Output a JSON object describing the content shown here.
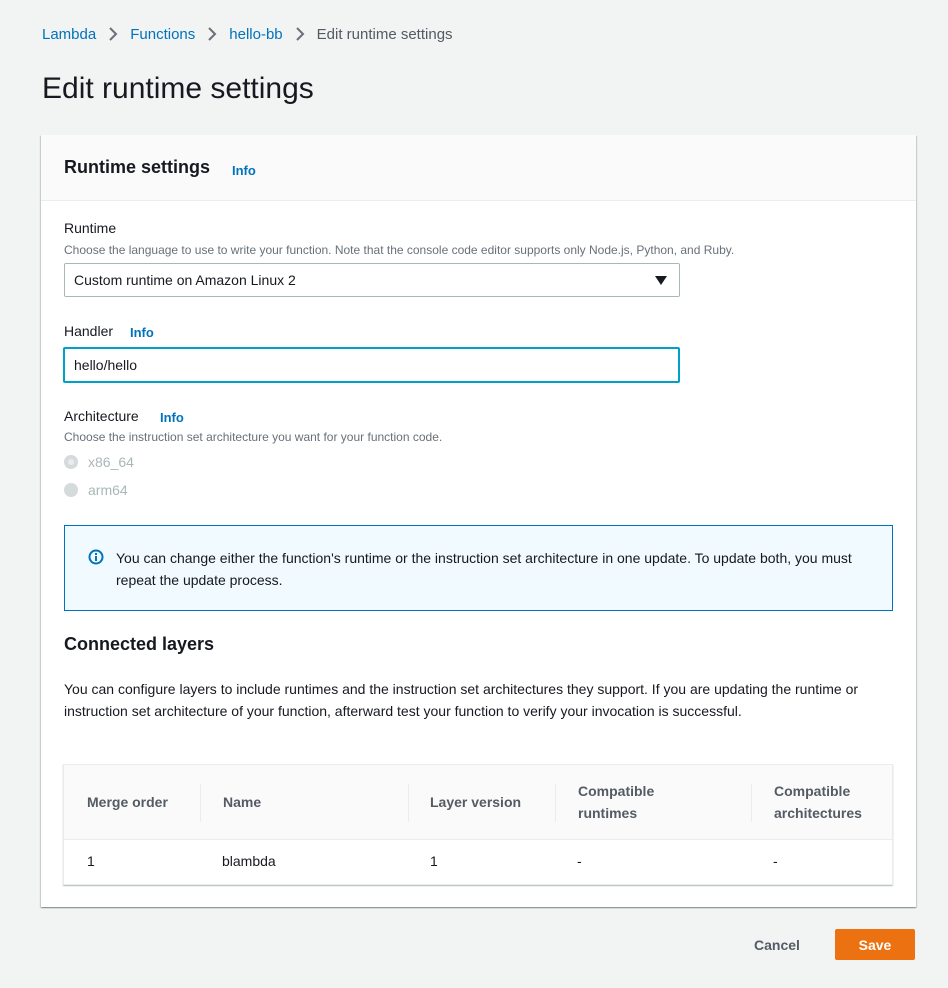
{
  "breadcrumb": {
    "items": [
      "Lambda",
      "Functions",
      "hello-bb"
    ],
    "current": "Edit runtime settings"
  },
  "page_title": "Edit runtime settings",
  "panel": {
    "title": "Runtime settings",
    "info": "Info",
    "runtime": {
      "label": "Runtime",
      "description": "Choose the language to use to write your function. Note that the console code editor supports only Node.js, Python, and Ruby.",
      "selected": "Custom runtime on Amazon Linux 2"
    },
    "handler": {
      "label": "Handler",
      "info": "Info",
      "value": "hello/hello"
    },
    "architecture": {
      "label": "Architecture",
      "info": "Info",
      "description": "Choose the instruction set architecture you want for your function code.",
      "options": [
        "x86_64",
        "arm64"
      ],
      "selected": "x86_64",
      "disabled": true
    },
    "alert": {
      "text": "You can change either the function's runtime or the instruction set architecture in one update. To update both, you must repeat the update process."
    },
    "layers": {
      "title": "Connected layers",
      "description": "You can configure layers to include runtimes and the instruction set architectures they support. If you are updating the runtime or instruction set architecture of your function, afterward test your function to verify your invocation is successful.",
      "columns": [
        "Merge order",
        "Name",
        "Layer version",
        "Compatible runtimes",
        "Compatible architectures"
      ],
      "rows": [
        [
          "1",
          "blambda",
          "1",
          "-",
          "-"
        ]
      ]
    }
  },
  "actions": {
    "cancel": "Cancel",
    "save": "Save"
  },
  "colors": {
    "link": "#0073bb",
    "primary": "#ec7211",
    "focus": "#00a1c9",
    "alert_bg": "#f1faff"
  }
}
